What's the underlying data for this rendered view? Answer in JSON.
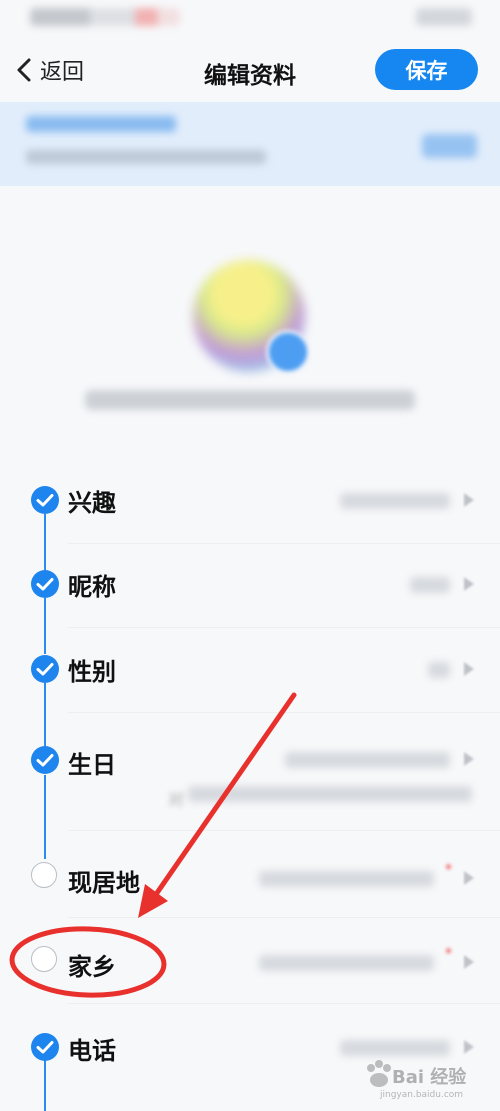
{
  "header": {
    "back_label": "返回",
    "title": "编辑资料",
    "save_label": "保存"
  },
  "fields": [
    {
      "label": "兴趣",
      "completed": true
    },
    {
      "label": "昵称",
      "completed": true
    },
    {
      "label": "性别",
      "completed": true
    },
    {
      "label": "生日",
      "completed": true
    },
    {
      "label": "现居地",
      "completed": false
    },
    {
      "label": "家乡",
      "completed": false
    },
    {
      "label": "电话",
      "completed": true
    }
  ],
  "hint_visible_fragment": "对",
  "watermark": {
    "text": "Bai 经验",
    "url": "jingyan.baidu.com"
  },
  "colors": {
    "accent": "#1687f0",
    "annotation": "#e8302c",
    "banner_bg": "#e1edfb"
  }
}
